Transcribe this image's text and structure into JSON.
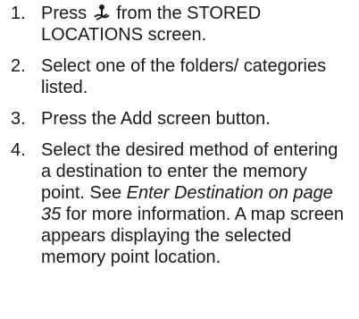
{
  "steps": [
    {
      "number": "1.",
      "text_before_icon": "Press ",
      "icon": "memory-pin-icon",
      "text_after_icon": " from the STORED LOCATIONS screen."
    },
    {
      "number": "2.",
      "text": "Select one of the folders/ categories listed."
    },
    {
      "number": "3.",
      "text": "Press the Add screen button."
    },
    {
      "number": "4.",
      "text_before": "Select the desired method of entering a destination to enter the memory point. See ",
      "link_text": "Enter Destination on page 35",
      "text_after": " for more information. A map screen appears displaying the selected memory point location."
    }
  ]
}
